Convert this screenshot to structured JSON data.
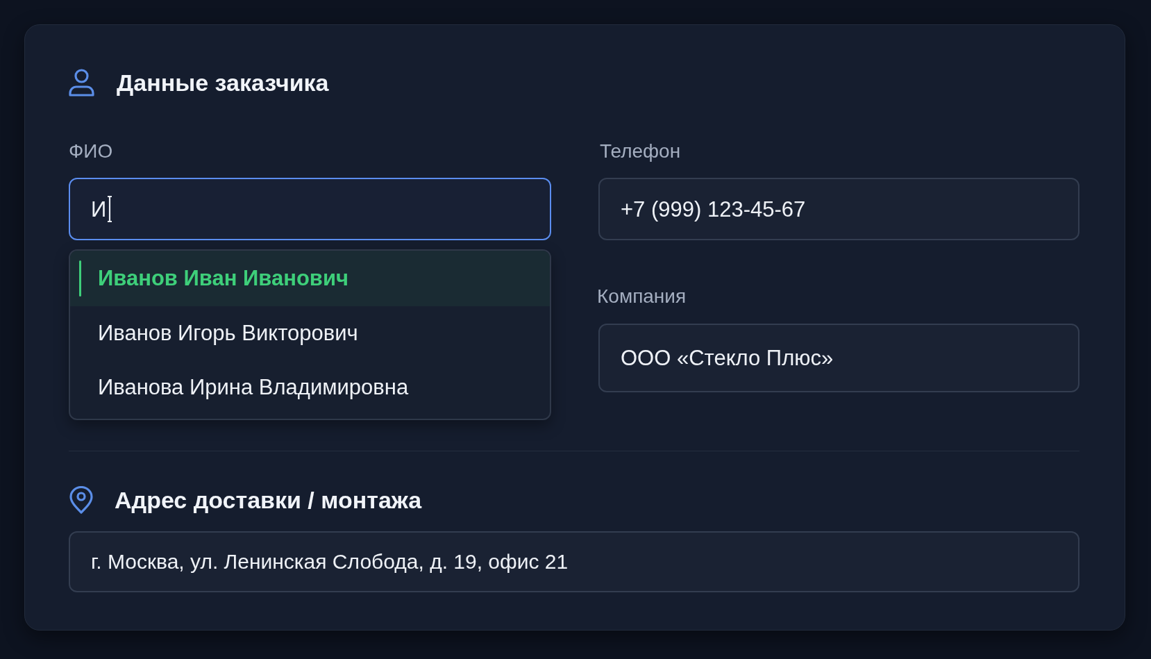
{
  "customer": {
    "title": "Данные заказчика",
    "fields": [
      {
        "label": "ФИО",
        "value": "И",
        "focused": true,
        "suggestions": [
          {
            "text": "Иванов Иван Иванович",
            "selected": true
          },
          {
            "text": "Иванов Игорь Викторович",
            "selected": false
          },
          {
            "text": "Иванова Ирина Владимировна",
            "selected": false
          }
        ]
      },
      {
        "label": "Телефон",
        "value": "+7 (999) 123-45-67",
        "focused": false
      },
      {
        "label": "Компания",
        "value": "ООО «Стекло Плюс»",
        "focused": false
      }
    ]
  },
  "address": {
    "title": "Адрес доставки / монтажа",
    "value": "г. Москва, ул. Ленинская Слобода, д. 19, офис 21",
    "focused": false
  }
}
